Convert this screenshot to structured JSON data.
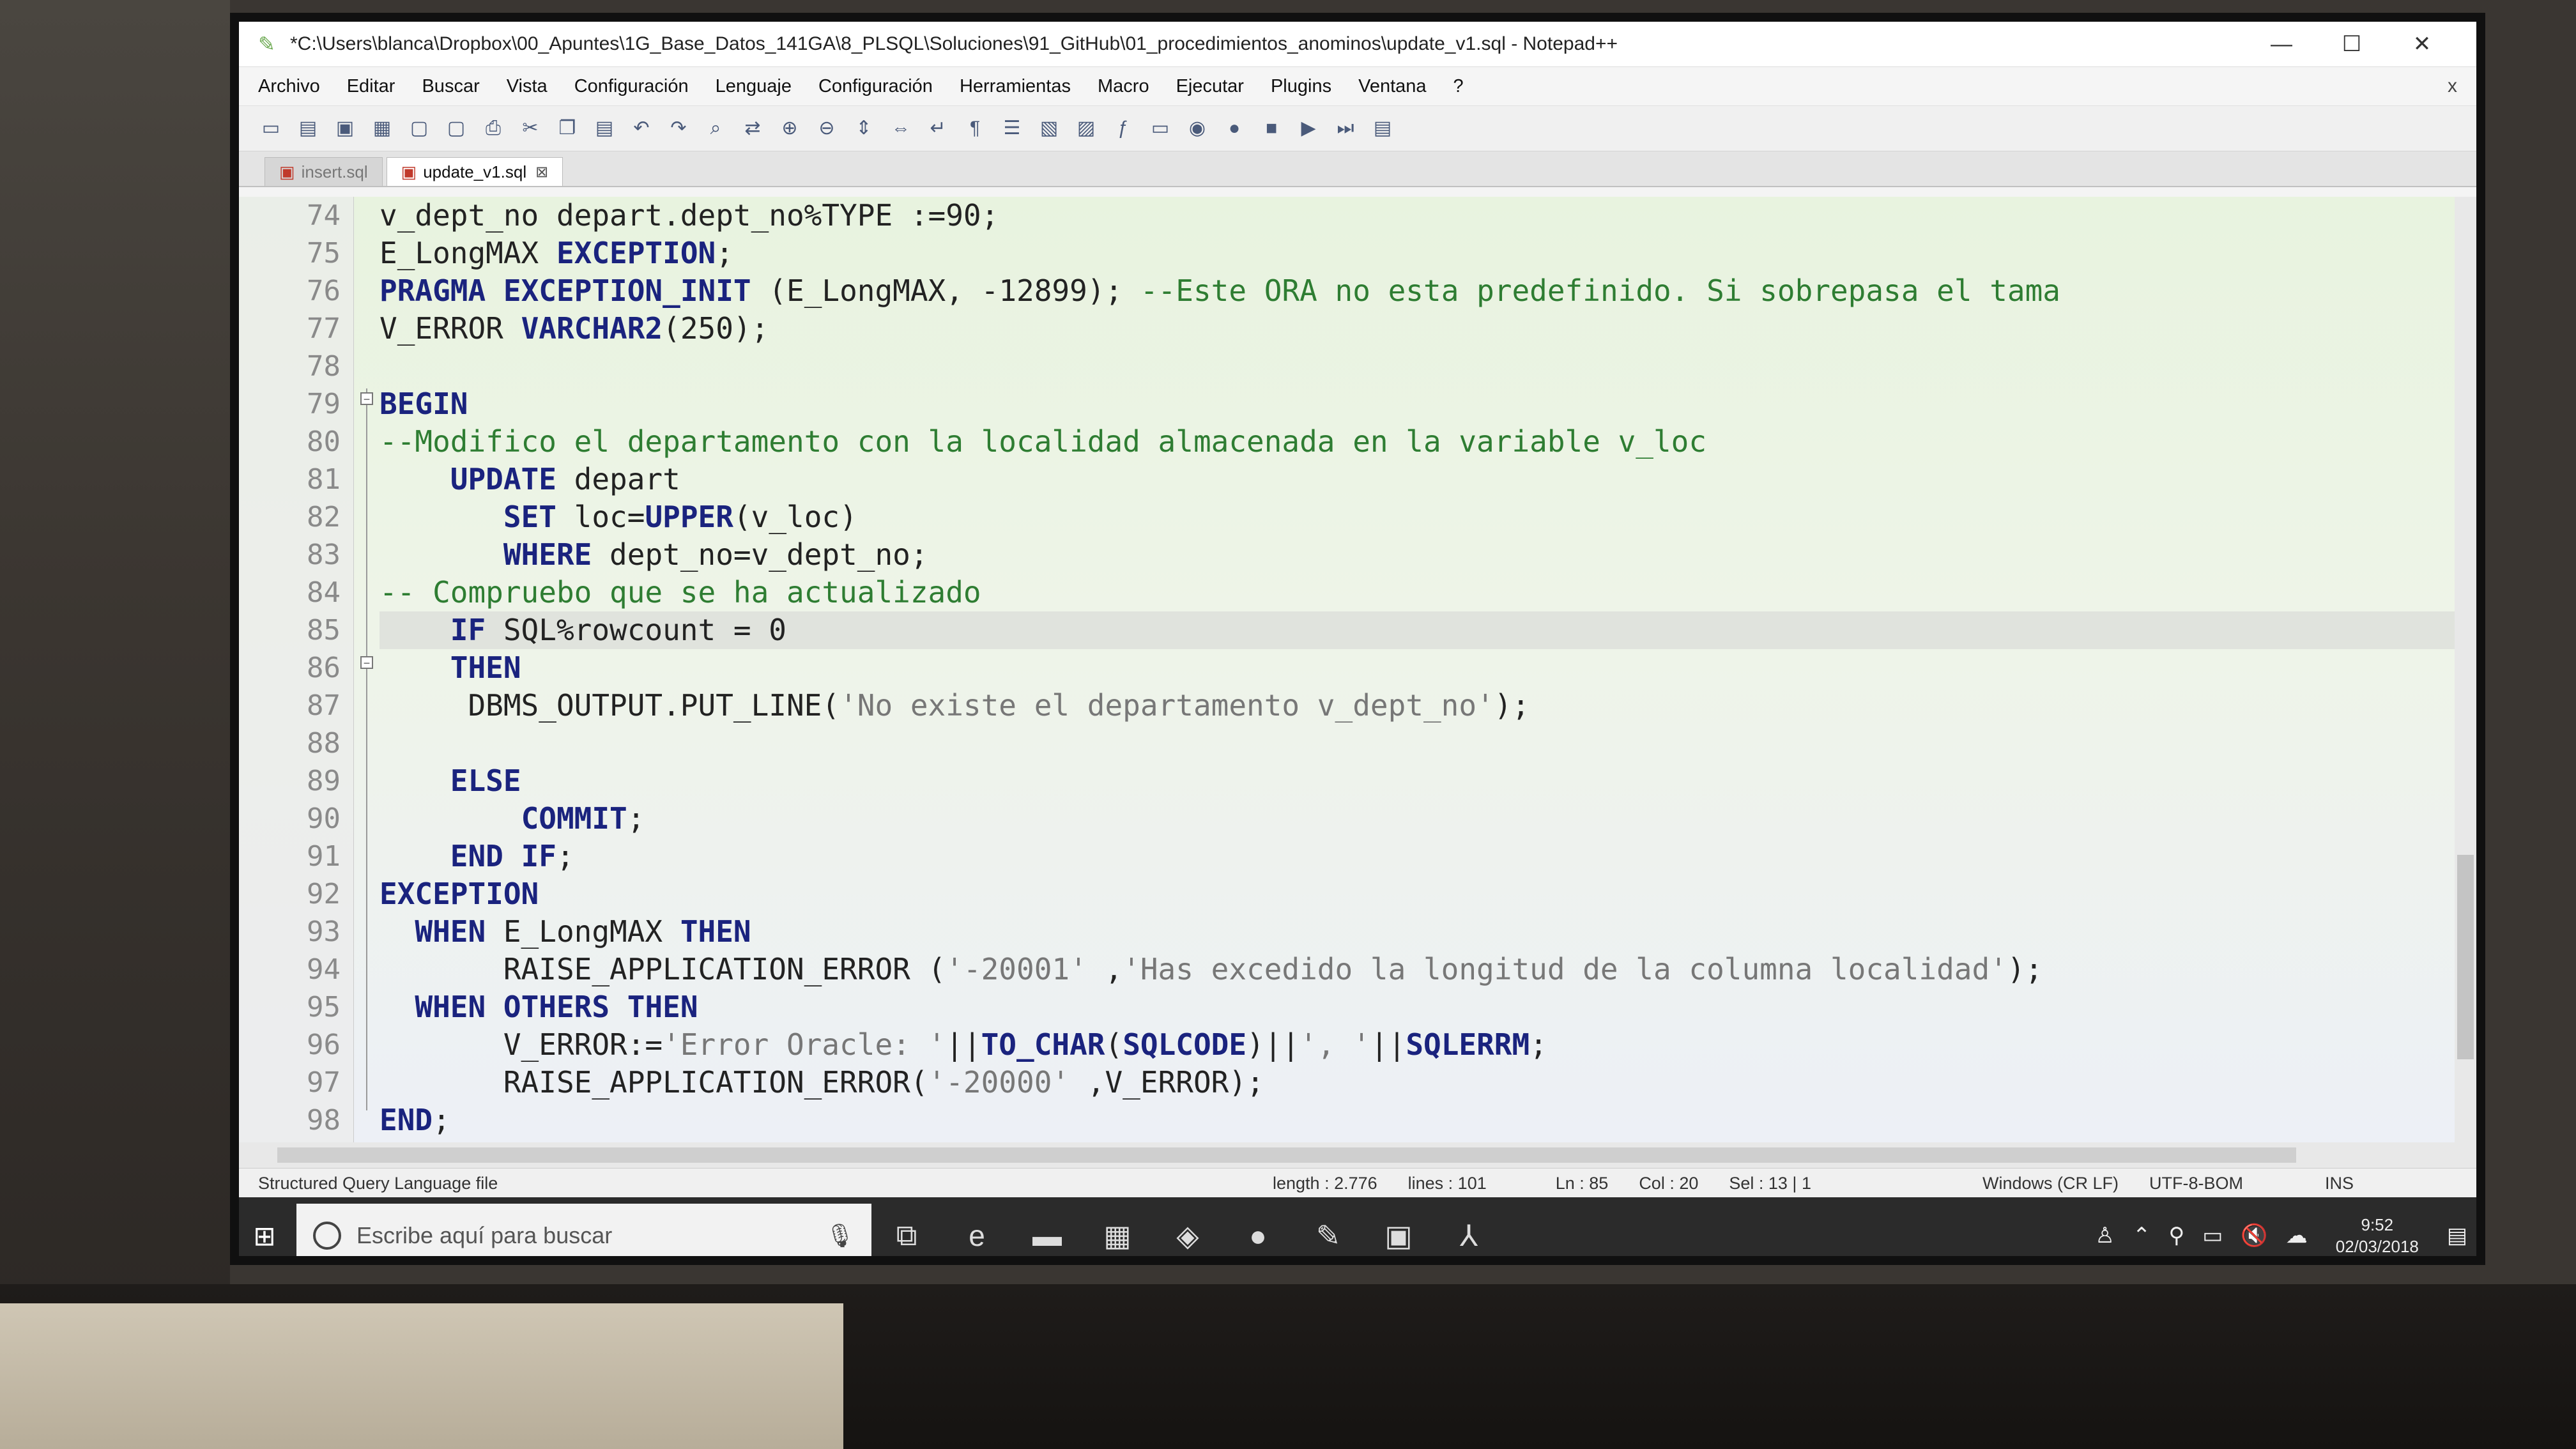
{
  "window": {
    "title": "*C:\\Users\\blanca\\Dropbox\\00_Apuntes\\1G_Base_Datos_141GA\\8_PLSQL\\Soluciones\\91_GitHub\\01_procedimientos_anominos\\update_v1.sql - Notepad++",
    "minimize": "—",
    "maximize": "☐",
    "close": "✕"
  },
  "menu": {
    "items": [
      "Archivo",
      "Editar",
      "Buscar",
      "Vista",
      "Configuración",
      "Lenguaje",
      "Configuración",
      "Herramientas",
      "Macro",
      "Ejecutar",
      "Plugins",
      "Ventana",
      "?"
    ],
    "close": "x"
  },
  "toolbar": {
    "icons": [
      "new-file-icon",
      "open-file-icon",
      "save-icon",
      "save-all-icon",
      "close-icon",
      "close-all-icon",
      "print-icon",
      "cut-icon",
      "copy-icon",
      "paste-icon",
      "undo-icon",
      "redo-icon",
      "find-icon",
      "replace-icon",
      "zoom-in-icon",
      "zoom-out-icon",
      "sync-v-icon",
      "sync-h-icon",
      "word-wrap-icon",
      "show-all-chars-icon",
      "indent-guide-icon",
      "lang-icon",
      "doc-map-icon",
      "function-list-icon",
      "folder-icon",
      "monitor-icon",
      "record-macro-icon",
      "stop-macro-icon",
      "play-macro-icon",
      "run-macro-multiple-icon",
      "save-macro-icon"
    ]
  },
  "tabs": [
    {
      "label": "insert.sql",
      "active": false
    },
    {
      "label": "update_v1.sql",
      "active": true
    }
  ],
  "editor": {
    "current_line": 85,
    "lines": [
      {
        "n": "74",
        "code": "v_dept_no depart.dept_no%TYPE :=90;"
      },
      {
        "n": "75",
        "code": "E_LongMAX EXCEPTION;"
      },
      {
        "n": "76",
        "code": "PRAGMA EXCEPTION_INIT (E_LongMAX, -12899); --Este ORA no esta predefinido. Si sobrepasa el tama"
      },
      {
        "n": "77",
        "code": "V_ERROR VARCHAR2(250);"
      },
      {
        "n": "78",
        "code": ""
      },
      {
        "n": "79",
        "code": "BEGIN"
      },
      {
        "n": "80",
        "code": "--Modifico el departamento con la localidad almacenada en la variable v_loc"
      },
      {
        "n": "81",
        "code": "    UPDATE depart"
      },
      {
        "n": "82",
        "code": "       SET loc=UPPER(v_loc)"
      },
      {
        "n": "83",
        "code": "       WHERE dept_no=v_dept_no;"
      },
      {
        "n": "84",
        "code": "-- Compruebo que se ha actualizado"
      },
      {
        "n": "85",
        "code": "    IF SQL%rowcount = 0"
      },
      {
        "n": "86",
        "code": "    THEN"
      },
      {
        "n": "87",
        "code": "     DBMS_OUTPUT.PUT_LINE('No existe el departamento v_dept_no');"
      },
      {
        "n": "88",
        "code": ""
      },
      {
        "n": "89",
        "code": "    ELSE"
      },
      {
        "n": "90",
        "code": "        COMMIT;"
      },
      {
        "n": "91",
        "code": "    END IF;"
      },
      {
        "n": "92",
        "code": "EXCEPTION"
      },
      {
        "n": "93",
        "code": "  WHEN E_LongMAX THEN"
      },
      {
        "n": "94",
        "code": "       RAISE_APPLICATION_ERROR ('-20001' ,'Has excedido la longitud de la columna localidad');"
      },
      {
        "n": "95",
        "code": "  WHEN OTHERS THEN"
      },
      {
        "n": "96",
        "code": "       V_ERROR:='Error Oracle: '||TO_CHAR(SQLCODE)||', '||SQLERRM;"
      },
      {
        "n": "97",
        "code": "       RAISE_APPLICATION_ERROR('-20000' ,V_ERROR);"
      },
      {
        "n": "98",
        "code": "END;"
      }
    ]
  },
  "status": {
    "language": "Structured Query Language file",
    "length": "length : 2.776",
    "lines": "lines : 101",
    "ln": "Ln : 85",
    "col": "Col : 20",
    "sel": "Sel : 13 | 1",
    "eol": "Windows (CR LF)",
    "encoding": "UTF-8-BOM",
    "mode": "INS"
  },
  "taskbar": {
    "search_placeholder": "Escribe aquí para buscar",
    "time": "9:52",
    "date": "02/03/2018"
  },
  "colors": {
    "keyword": "#1a237e",
    "comment": "#2e7d32",
    "string": "#777777",
    "editor_bg_top": "#e8f3df"
  }
}
